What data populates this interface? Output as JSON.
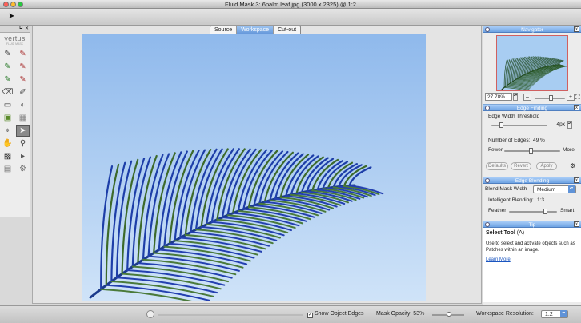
{
  "window": {
    "title": "Fluid Mask 3: 6palm leaf.jpg (3000 x 2325) @ 1:2"
  },
  "palette": {
    "brand": "vertus",
    "brand_sub": "FLUID MASK",
    "close_glyph": "✕",
    "collapse_glyph": "⧉",
    "tools": [
      {
        "name": "keep-brush-icon",
        "glyph": "✎"
      },
      {
        "name": "delete-brush-icon",
        "glyph": "✎"
      },
      {
        "name": "keep-local-brush-icon",
        "glyph": "✎"
      },
      {
        "name": "delete-local-brush-icon",
        "glyph": "✎"
      },
      {
        "name": "keep-local-brush-2-icon",
        "glyph": "✎"
      },
      {
        "name": "delete-local-brush-2-icon",
        "glyph": "✎"
      },
      {
        "name": "eraser-icon",
        "glyph": "⌫"
      },
      {
        "name": "repair-brush-icon",
        "glyph": "✐"
      },
      {
        "name": "rectangle-select-icon",
        "glyph": "▭"
      },
      {
        "name": "color-picker-icon",
        "glyph": "◐"
      },
      {
        "name": "keep-patch-icon",
        "glyph": "▣"
      },
      {
        "name": "delete-patch-icon",
        "glyph": "▦"
      },
      {
        "name": "blend-tool-icon",
        "glyph": "⌖"
      },
      {
        "name": "select-tool-icon",
        "glyph": "➤"
      },
      {
        "name": "hand-tool-icon",
        "glyph": "✋"
      },
      {
        "name": "zoom-tool-icon",
        "glyph": "⚲"
      },
      {
        "name": "checkerboard-icon",
        "glyph": "▩"
      },
      {
        "name": "palette-option-icon",
        "glyph": "▸"
      },
      {
        "name": "object-tool-icon",
        "glyph": "▤"
      },
      {
        "name": "help-tool-icon",
        "glyph": "⚙"
      }
    ]
  },
  "view_tabs": [
    {
      "label": "Source",
      "active": false
    },
    {
      "label": "Workspace",
      "active": true
    },
    {
      "label": "Cut-out",
      "active": false
    }
  ],
  "status": {
    "show_object_edges_label": "Show Object Edges",
    "show_object_edges_checked": true,
    "checkmark": "✓",
    "mask_opacity_label": "Mask Opacity: 53%",
    "mask_opacity_value": 0.53,
    "workspace_resolution_label": "Workspace Resolution:",
    "workspace_resolution_value": "1:2"
  },
  "navigator": {
    "title": "Navigator",
    "zoom_value": "27.78%",
    "zoom_minus": "–",
    "zoom_plus": "+",
    "zoom_level": 0.55,
    "fit_icon": "⛶"
  },
  "edge_finding": {
    "title": "Edge Finding",
    "threshold_label": "Edge Width Threshold",
    "threshold_value": "4px",
    "threshold_level": 0.15,
    "edges_label": "Number of Edges:",
    "edges_value": "49 %",
    "edges_level": 0.49,
    "fewer_label": "Fewer",
    "more_label": "More",
    "buttons": [
      "Defaults",
      "Revert",
      "Apply"
    ],
    "gear_icon": "⚙"
  },
  "edge_blending": {
    "title": "Edge Blending",
    "blend_mask_width_label": "Blend Mask Width",
    "blend_mask_width_value": "Medium",
    "intelligent_label": "Intelligent Blending:",
    "intelligent_value": "1:3",
    "feather_label": "Feather",
    "smart_label": "Smart",
    "intelligent_level": 0.8
  },
  "tip": {
    "title": "Tip",
    "heading": "Select Tool",
    "shortcut": "(A)",
    "body": "Use to select and activate objects such as Patches within an image.",
    "link": "Learn More"
  },
  "panel_close_glyph": "x",
  "stepper_glyph": "▴▾"
}
